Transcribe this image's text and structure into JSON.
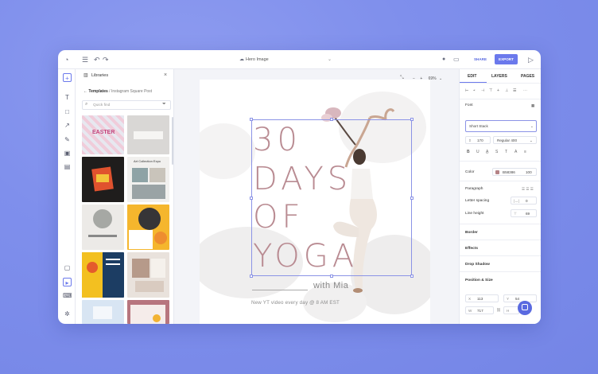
{
  "topbar": {
    "doc_title": "Hero Image",
    "share_label": "SHARE",
    "export_label": "EXPORT"
  },
  "library": {
    "title": "Libraries",
    "crumb_main": "Templates",
    "crumb_sub": "/ Instagram Square Post",
    "search_placeholder": "Quick find",
    "thumbs": [
      {
        "label": "EASTER",
        "bg": "#eadbe6"
      },
      {
        "label": "",
        "bg": "#d9d7d5"
      },
      {
        "label": "",
        "bg": "#1f1d1c"
      },
      {
        "label": "Art Collection Expo",
        "bg": "#f1f0ee"
      },
      {
        "label": "",
        "bg": "#eceae7"
      },
      {
        "label": "",
        "bg": "#f5b62d"
      },
      {
        "label": "",
        "bg": "#1c3d63"
      },
      {
        "label": "",
        "bg": "#e9e2dc"
      },
      {
        "label": "",
        "bg": "#d8e5f3"
      },
      {
        "label": "",
        "bg": "#b7757e"
      }
    ]
  },
  "canvas": {
    "zoom": "69%",
    "headline": [
      "30",
      "DAYS",
      "OF",
      "YOGA"
    ],
    "with_text": "with Mia",
    "subline": "New YT video every day @ 8 AM EST"
  },
  "props": {
    "tabs": [
      "EDIT",
      "LAYERS",
      "PAGES"
    ],
    "font_section": "Font",
    "font_name": "Short Stack",
    "font_size": "170",
    "font_weight": "Regular 400",
    "color_label": "Color",
    "color_hex": "B58386",
    "color_opacity": "100",
    "color_swatch": "#b58386",
    "paragraph_label": "Paragraph",
    "letter_spacing_label": "Letter spacing",
    "letter_spacing_value": "0",
    "line_height_label": "Line height",
    "line_height_value": "69",
    "border_label": "Border",
    "effects_label": "Effects",
    "drop_shadow_label": "Drop Shadow",
    "position_label": "Position & Size",
    "pos_x_label": "X",
    "pos_x": "113",
    "pos_y_label": "Y",
    "pos_y": "54",
    "size_w_label": "W",
    "size_w": "717",
    "size_h_label": "H"
  },
  "colors": {
    "accent": "#6b79ec",
    "headline": "#b98b92"
  }
}
